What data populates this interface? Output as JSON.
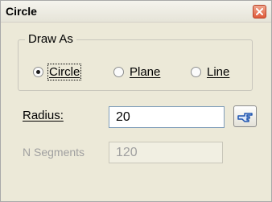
{
  "window": {
    "title": "Circle",
    "close_icon": "close-icon"
  },
  "draw_as": {
    "legend": "Draw As",
    "options": [
      {
        "label": "Circle",
        "checked": true
      },
      {
        "label": "Plane",
        "checked": false
      },
      {
        "label": "Line",
        "checked": false
      }
    ]
  },
  "radius": {
    "label": "Radius:",
    "value": "20",
    "pick_icon": "pointing-hand-icon"
  },
  "segments": {
    "label": "N Segments",
    "value": "120",
    "disabled": true
  },
  "colors": {
    "window_bg": "#ece9d8",
    "close_button": "#e05a3a",
    "pick_icon": "#1f55b0",
    "disabled_text": "#a0a0a0"
  }
}
